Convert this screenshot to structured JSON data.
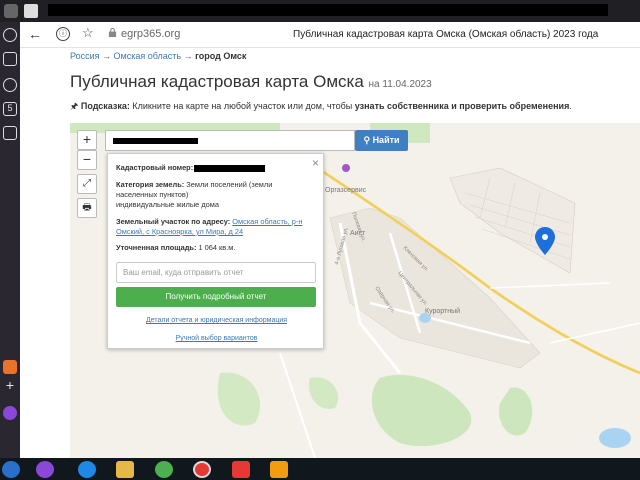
{
  "browser": {
    "url": "egrp365.org",
    "page_title": "Публичная кадастровая карта Омска (Омская область) 2023 года",
    "sidebar_badge": "5"
  },
  "breadcrumb": {
    "items": [
      "Россия",
      "Омская область"
    ],
    "current": "город Омск",
    "separator": "→"
  },
  "heading": {
    "title": "Публичная кадастровая карта Омска",
    "date": "на 11.04.2023"
  },
  "hint": {
    "label": "Подсказка:",
    "text": " Кликните на карте на любой участок или дом, чтобы ",
    "bold_text": "узнать собственника и проверить обременения",
    "end": "."
  },
  "map": {
    "zoom_in": "+",
    "zoom_out": "−",
    "search_button": "Найти",
    "labels": {
      "gas": "Оргазсервис",
      "aist": "Аист",
      "kurort": "Курортный",
      "street1": "4-я Луговая ул.",
      "street2": "Полевая ул.",
      "street3": "Кленовая ул.",
      "street4": "Центральная ул.",
      "street5": "Озёрная ул."
    }
  },
  "popup": {
    "cad_label": "Кадастровый номер:",
    "cat_label": "Категория земель:",
    "cat_value_1": "Земли поселений (земли",
    "cat_value_2": "населенных пунктов)",
    "cat_value_3": "индивидуальные жилые дома",
    "addr_label": "Земельный участок по адресу:",
    "addr_value_1": "Омская область, р-н",
    "addr_value_2": "Омский, с Красноярка, ул Мира, д 24",
    "area_label": "Уточненная площадь:",
    "area_value": "1 064 кв.м.",
    "email_placeholder": "Ваш email, куда отправить отчет",
    "get_button": "Получить подробный отчет",
    "details_link": "Детали отчета и юридическая информация",
    "manual_link": "Ручной выбор вариантов",
    "close": "×"
  },
  "colors": {
    "link": "#3b7ab8",
    "search_button": "#3f7fc3",
    "report_button": "#4cae4c",
    "marker": "#1e6fd9"
  }
}
